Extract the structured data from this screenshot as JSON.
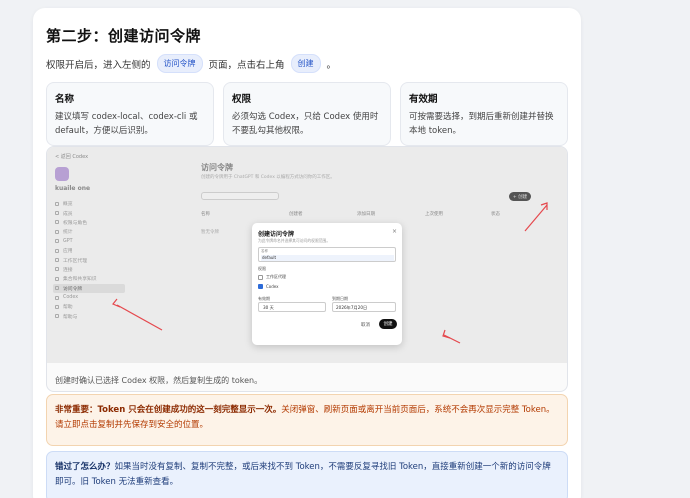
{
  "step": {
    "title": "第二步：创建访问令牌",
    "intro_prefix": "权限开启后，进入左侧的",
    "intro_pill1": "访问令牌",
    "intro_mid": "页面，点击右上角",
    "intro_pill2": "创建",
    "intro_suffix": "。"
  },
  "cards": [
    {
      "title": "名称",
      "text": "建议填写 codex-local、codex-cli 或 default，方便以后识别。"
    },
    {
      "title": "权限",
      "text": "必须勾选 Codex，只给 Codex 使用时不要乱勾其他权限。"
    },
    {
      "title": "有效期",
      "text": "可按需要选择，到期后重新创建并替换本地 token。"
    }
  ],
  "screenshot": {
    "caption": "创建时确认已选择 Codex 权限，然后复制生成的 token。",
    "back": "< 返回 Codex",
    "workspace": "kuaile one",
    "sidebar": [
      "概览",
      "成员",
      "权限与角色",
      "统计",
      "GPT",
      "应用",
      "工作区代理",
      "连接",
      "集合和共享知识",
      "访问令牌",
      "Codex",
      "帮助",
      "帮助与"
    ],
    "page_title": "访问令牌",
    "page_sub": "创建的令牌用于 ChatGPT 和 Codex 以编程方式访问你的工作区。",
    "create_btn": "+ 创建",
    "columns": [
      "名称",
      "创建者",
      "添加日期",
      "上次使用",
      "状态"
    ],
    "empty": "暂无令牌",
    "modal": {
      "title": "创建访问令牌",
      "sub": "为此令牌命名并选择其可访问的权限范围。",
      "close": "×",
      "name_label": "名称",
      "name_value": "default",
      "perm_label": "权限",
      "opt1": "工作区代理",
      "opt2": "Codex",
      "exp_label": "有效期",
      "exp_value": "30 天",
      "date_label": "到期日期",
      "date_value": "2026年7月20日",
      "cancel": "取消",
      "ok": "创建"
    }
  },
  "warning": {
    "lead": "非常重要：Token 只会在创建成功的这一刻完整显示一次。",
    "text": "关闭弹窗、刷新页面或离开当前页面后，系统不会再次显示完整 Token。请立即点击复制并先保存到安全的位置。"
  },
  "info": {
    "lead": "错过了怎么办？",
    "text": "如果当时没有复制、复制不完整，或后来找不到 Token，不需要反复寻找旧 Token，直接重新创建一个新的访问令牌即可。旧 Token 无法重新查看。"
  }
}
